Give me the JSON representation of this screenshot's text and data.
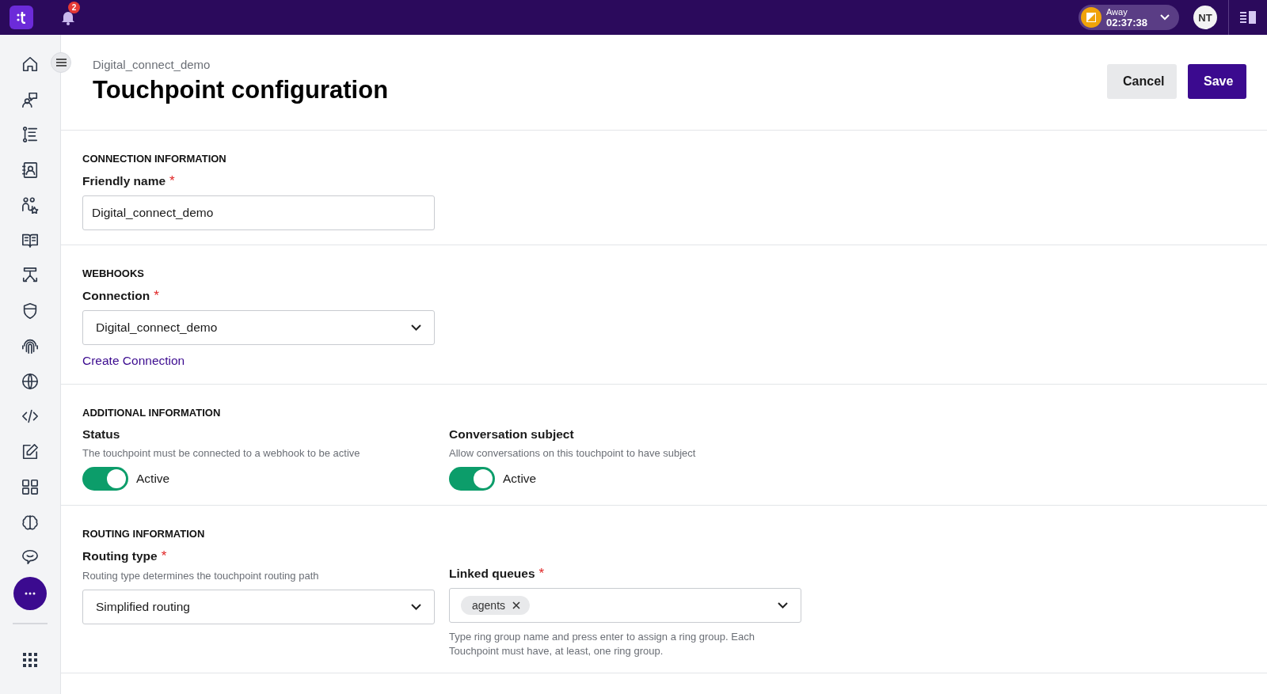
{
  "topbar": {
    "notification_count": "2",
    "status": {
      "label": "Away",
      "time": "02:37:38"
    },
    "avatar_initials": "NT"
  },
  "header": {
    "breadcrumb": "Digital_connect_demo",
    "title": "Touchpoint configuration",
    "buttons": [
      {
        "label": "Cancel",
        "kind": "secondary"
      },
      {
        "label": "Save",
        "kind": "primary"
      }
    ]
  },
  "sections": [
    {
      "title": "CONNECTION INFORMATION",
      "fields": [
        {
          "kind": "text",
          "label": "Friendly name",
          "required_mark": "*",
          "value": "Digital_connect_demo"
        }
      ]
    },
    {
      "title": "WEBHOOKS",
      "fields": [
        {
          "kind": "select",
          "label": "Connection",
          "required_mark": "*",
          "value": "Digital_connect_demo",
          "link": "Create Connection"
        }
      ]
    },
    {
      "title": "ADDITIONAL INFORMATION",
      "fields": [
        {
          "kind": "toggle",
          "label": "Status",
          "hint": "The touchpoint must be connected to a webhook to be active",
          "on": true,
          "state_label": "Active"
        },
        {
          "kind": "toggle",
          "label": "Conversation subject",
          "hint": "Allow conversations on this touchpoint to have subject",
          "on": true,
          "state_label": "Active"
        }
      ]
    },
    {
      "title": "ROUTING INFORMATION",
      "fields": [
        {
          "kind": "select",
          "label": "Routing type",
          "required_mark": "*",
          "hint": "Routing type determines the touchpoint routing path",
          "value": "Simplified routing"
        },
        {
          "kind": "tags",
          "label": "Linked queues",
          "required_mark": "*",
          "tags": [
            "agents"
          ],
          "help": "Type ring group name and press enter to assign a ring group. Each Touchpoint must have, at least, one ring group."
        }
      ]
    }
  ]
}
